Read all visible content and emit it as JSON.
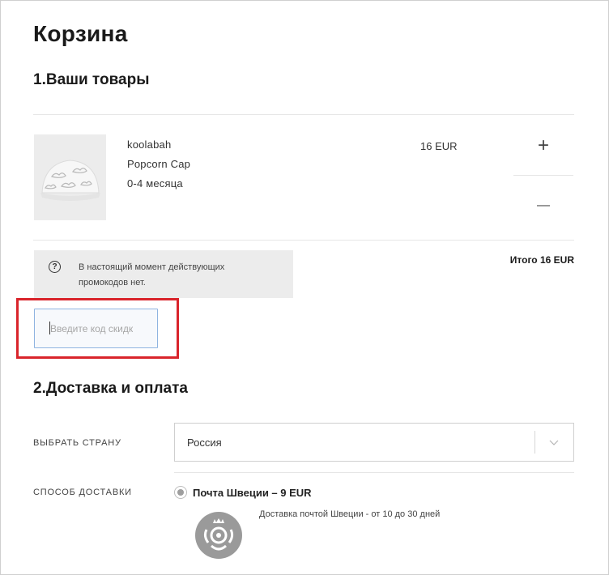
{
  "page_title": "Корзина",
  "section1_title": "1.Ваши товары",
  "product": {
    "brand": "koolabah",
    "name": "Popcorn Cap",
    "size": "0-4 месяца",
    "price": "16 EUR",
    "image_icon": "cap-image"
  },
  "quantity": {
    "plus_label": "+",
    "minus_label": "—"
  },
  "promo": {
    "icon": "?",
    "message": "В настоящий момент действующих промокодов нет."
  },
  "total_label": "Итого 16 EUR",
  "discount": {
    "placeholder": "Введите код скидк"
  },
  "section2_title": "2.Доставка и оплата",
  "country": {
    "label": "ВЫБРАТЬ СТРАНУ",
    "value": "Россия"
  },
  "delivery": {
    "label": "СПОСОБ ДОСТАВКИ",
    "option_name": "Почта Швеции – 9 EUR",
    "option_desc": "Доставка почтой Швеции - от 10 до 30 дней",
    "logo_icon": "posten-horn-icon"
  },
  "colors": {
    "highlight": "#d9242b",
    "input_border": "#8fb4e0",
    "panel_bg": "#ececec"
  }
}
